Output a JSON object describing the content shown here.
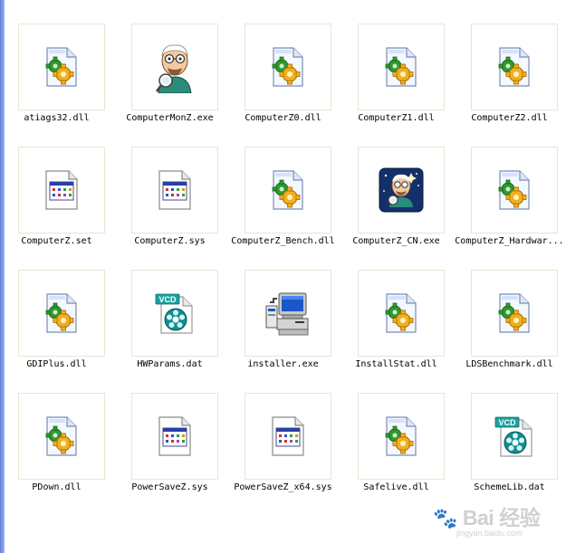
{
  "files": [
    {
      "name": "atiags32.dll",
      "icon": "dll-gear-icon"
    },
    {
      "name": "ComputerMonZ.exe",
      "icon": "mascot-man-icon"
    },
    {
      "name": "ComputerZ0.dll",
      "icon": "dll-gear-icon"
    },
    {
      "name": "ComputerZ1.dll",
      "icon": "dll-gear-icon"
    },
    {
      "name": "ComputerZ2.dll",
      "icon": "dll-gear-icon"
    },
    {
      "name": "ComputerZ.set",
      "icon": "window-file-icon"
    },
    {
      "name": "ComputerZ.sys",
      "icon": "window-file-icon"
    },
    {
      "name": "ComputerZ_Bench.dll",
      "icon": "dll-gear-icon"
    },
    {
      "name": "ComputerZ_CN.exe",
      "icon": "mascot-starry-icon"
    },
    {
      "name": "ComputerZ_Hardwar...",
      "icon": "dll-gear-icon"
    },
    {
      "name": "GDIPlus.dll",
      "icon": "dll-gear-icon"
    },
    {
      "name": "HWParams.dat",
      "icon": "vcd-disc-icon"
    },
    {
      "name": "installer.exe",
      "icon": "installer-computer-icon"
    },
    {
      "name": "InstallStat.dll",
      "icon": "dll-gear-icon"
    },
    {
      "name": "LDSBenchmark.dll",
      "icon": "dll-gear-icon"
    },
    {
      "name": "PDown.dll",
      "icon": "dll-gear-icon"
    },
    {
      "name": "PowerSaveZ.sys",
      "icon": "window-file-icon"
    },
    {
      "name": "PowerSaveZ_x64.sys",
      "icon": "window-file-icon"
    },
    {
      "name": "Safelive.dll",
      "icon": "dll-gear-icon"
    },
    {
      "name": "SchemeLib.dat",
      "icon": "vcd-disc-icon"
    }
  ],
  "icon_text": {
    "vcd": "VCD"
  },
  "watermark": {
    "brand": "Bai",
    "brand2": "经验",
    "url": "jingyan.baidu.com"
  }
}
